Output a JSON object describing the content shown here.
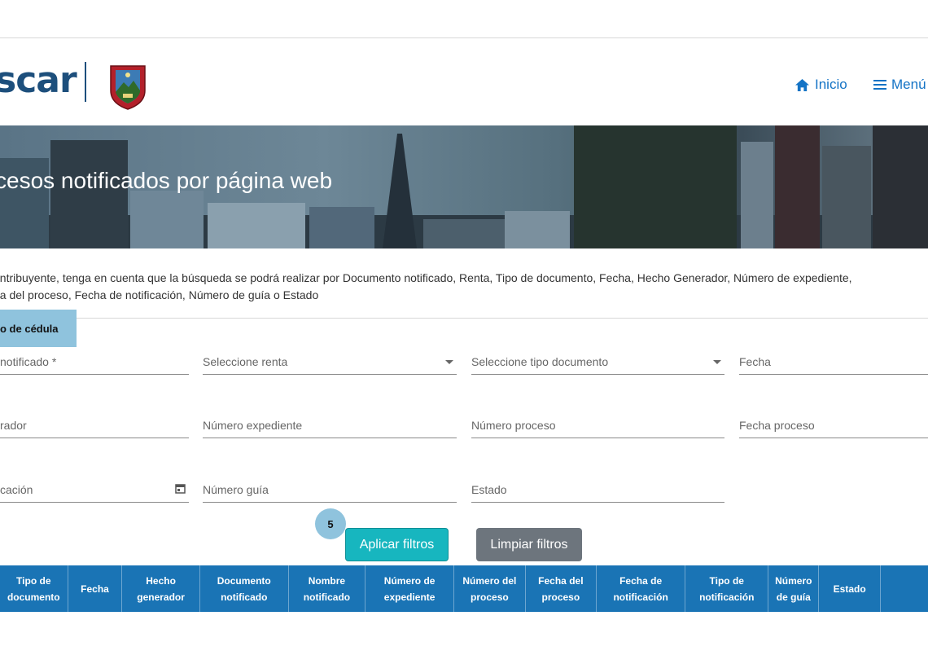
{
  "header": {
    "logo_text": "scar",
    "nav": [
      {
        "label": "Inicio",
        "icon": "home-icon"
      },
      {
        "label": "Menú",
        "icon": "menu-icon"
      }
    ]
  },
  "banner": {
    "title": "cesos notificados por página web"
  },
  "description": {
    "line1": "ontribuyente, tenga en cuenta que la búsqueda se podrá realizar por Documento notificado, Renta, Tipo de documento, Fecha, Hecho Generador, Número de expediente,",
    "line2": "na del proceso, Fecha de notificación, Número de guía o Estado"
  },
  "search_tag": "o de cédula",
  "filters": {
    "documento_notificado": "notificado *",
    "renta": "Seleccione renta",
    "tipo_documento": "Seleccione tipo documento",
    "fecha": "Fecha",
    "hecho_generador": "rador",
    "numero_expediente": "Número expediente",
    "numero_proceso": "Número proceso",
    "fecha_proceso": "Fecha proceso",
    "fecha_notificacion": "cación",
    "numero_guia": "Número guía",
    "estado": "Estado"
  },
  "step_badge": "5",
  "buttons": {
    "apply": "Aplicar filtros",
    "clear": "Limpiar filtros"
  },
  "table": {
    "columns": [
      {
        "l1": "Tipo de",
        "l2": "documento"
      },
      {
        "l1": "Fecha",
        "l2": ""
      },
      {
        "l1": "Hecho",
        "l2": "generador"
      },
      {
        "l1": "Documento",
        "l2": "notificado"
      },
      {
        "l1": "Nombre",
        "l2": "notificado"
      },
      {
        "l1": "Número de",
        "l2": "expediente"
      },
      {
        "l1": "Número del",
        "l2": "proceso"
      },
      {
        "l1": "Fecha del",
        "l2": "proceso"
      },
      {
        "l1": "Fecha de",
        "l2": "notificación"
      },
      {
        "l1": "Tipo de",
        "l2": "notificación"
      },
      {
        "l1": "Número",
        "l2": "de guía"
      },
      {
        "l1": "Estado",
        "l2": ""
      }
    ]
  },
  "colors": {
    "brand": "#1d4f7c",
    "link": "#1473c5",
    "table_header": "#1a74b5",
    "apply": "#17b6bf",
    "clear": "#6d757d",
    "tag": "#8fc3dd"
  }
}
